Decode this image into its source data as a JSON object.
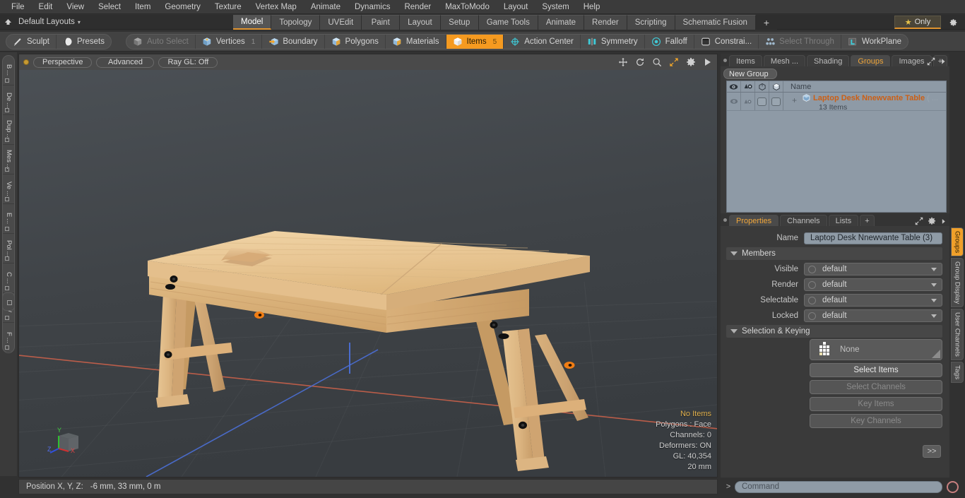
{
  "menu": {
    "items": [
      "File",
      "Edit",
      "View",
      "Select",
      "Item",
      "Geometry",
      "Texture",
      "Vertex Map",
      "Animate",
      "Dynamics",
      "Render",
      "MaxToModo",
      "Layout",
      "System",
      "Help"
    ]
  },
  "layout_bar": {
    "home_icon": "home-up-icon",
    "label": "Default Layouts",
    "caret": "▾",
    "tabs": [
      {
        "label": "Model",
        "active": true
      },
      {
        "label": "Topology",
        "active": false
      },
      {
        "label": "UVEdit",
        "active": false
      },
      {
        "label": "Paint",
        "active": false
      },
      {
        "label": "Layout",
        "active": false
      },
      {
        "label": "Setup",
        "active": false
      },
      {
        "label": "Game Tools",
        "active": false
      },
      {
        "label": "Animate",
        "active": false
      },
      {
        "label": "Render",
        "active": false
      },
      {
        "label": "Scripting",
        "active": false
      },
      {
        "label": "Schematic Fusion",
        "active": false
      }
    ],
    "add_label": "+",
    "only_label": "Only",
    "star_glyph": "★",
    "gear_icon": "gear-icon"
  },
  "mode_bar": {
    "group1": [
      {
        "label": "Sculpt",
        "icon": "pencil-icon",
        "state": "normal"
      },
      {
        "label": "Presets",
        "icon": "sphere-icon",
        "state": "normal"
      }
    ],
    "group2": [
      {
        "label": "Auto Select",
        "icon": "cube-gray-icon",
        "state": "dim"
      },
      {
        "label": "Vertices",
        "icon": "cube-vertex-icon",
        "state": "normal",
        "count": "1"
      },
      {
        "label": "Boundary",
        "icon": "cube-arrow-icon",
        "state": "normal"
      },
      {
        "label": "Polygons",
        "icon": "cube-blue-icon",
        "state": "normal"
      },
      {
        "label": "Materials",
        "icon": "cube-blue-icon",
        "state": "normal"
      },
      {
        "label": "Items",
        "icon": "cube-white-icon",
        "state": "selected",
        "count": "5"
      },
      {
        "label": "Action Center",
        "icon": "target-icon",
        "state": "normal"
      },
      {
        "label": "Symmetry",
        "icon": "symmetry-icon",
        "state": "normal"
      },
      {
        "label": "Falloff",
        "icon": "falloff-icon",
        "state": "normal"
      },
      {
        "label": "Constrai...",
        "icon": "constraint-icon",
        "state": "normal"
      },
      {
        "label": "Select Through",
        "icon": "select-through-icon",
        "state": "dim"
      },
      {
        "label": "WorkPlane",
        "icon": "workplane-icon",
        "state": "normal"
      }
    ]
  },
  "left_tabs": [
    "B ...",
    "De ...",
    "Dup ...",
    "Mes ...",
    "Ve ...",
    "E ...",
    "Pol ...",
    "C ...",
    "UV",
    "F ..."
  ],
  "viewport": {
    "mode_label": "Perspective",
    "quality_label": "Advanced",
    "raygl_label": "Ray GL: Off",
    "header_icons": [
      "move-icon",
      "rotate-icon",
      "zoom-icon",
      "fit-icon",
      "gear-icon",
      "play-icon"
    ],
    "info": {
      "items": "No Items",
      "polygons": "Polygons : Face",
      "channels": "Channels: 0",
      "deformers": "Deformers: ON",
      "gl": "GL: 40,354",
      "scale": "20 mm"
    },
    "axis": {
      "x": "X",
      "y": "Y",
      "z": "Z"
    },
    "model_name": "laptop-desk-table-3d-model"
  },
  "status_bar": {
    "label": "Position X, Y, Z:",
    "value": "-6 mm, 33 mm, 0 m"
  },
  "right_panel": {
    "tabs": [
      {
        "label": "Items",
        "active": false
      },
      {
        "label": "Mesh ...",
        "active": false
      },
      {
        "label": "Shading",
        "active": false
      },
      {
        "label": "Groups",
        "active": true
      },
      {
        "label": "Images",
        "active": false
      },
      {
        "label": "+",
        "active": false
      }
    ],
    "new_group_label": "New Group",
    "list": {
      "header_cols": [
        "eye-icon",
        "render-icon",
        "outline-cube-icon",
        "shaded-cube-icon"
      ],
      "name_header": "Name",
      "rows": [
        {
          "title": "Laptop Desk Nnewvante Table",
          "paren": "(",
          "ellipsis": "...",
          "subtitle": "13 Items",
          "expand": "+"
        }
      ]
    }
  },
  "properties": {
    "tabs": [
      {
        "label": "Properties",
        "active": true
      },
      {
        "label": "Channels",
        "active": false
      },
      {
        "label": "Lists",
        "active": false
      },
      {
        "label": "+",
        "active": false
      }
    ],
    "name_label": "Name",
    "name_value": "Laptop Desk Nnewvante Table (3)",
    "members_section": "Members",
    "fields": [
      {
        "label": "Visible",
        "value": "default"
      },
      {
        "label": "Render",
        "value": "default"
      },
      {
        "label": "Selectable",
        "value": "default"
      },
      {
        "label": "Locked",
        "value": "default"
      }
    ],
    "selection_section": "Selection & Keying",
    "keyset_value": "None",
    "buttons": [
      {
        "label": "Select Items",
        "enabled": true
      },
      {
        "label": "Select Channels",
        "enabled": false
      },
      {
        "label": "Key Items",
        "enabled": false
      },
      {
        "label": "Key Channels",
        "enabled": false
      }
    ],
    "more_label": ">>"
  },
  "right_vtabs": [
    {
      "label": "Groups",
      "active": true
    },
    {
      "label": "Group Display",
      "active": false
    },
    {
      "label": "User Channels",
      "active": false
    },
    {
      "label": "Tags",
      "active": false
    }
  ],
  "command_bar": {
    "prompt": ">",
    "placeholder": "Command",
    "record_icon": "record-circle-icon"
  },
  "colors": {
    "accent_orange": "#f0a02a",
    "selected_orange": "#f59a20",
    "panel_bg": "#3a3a3a",
    "list_blue": "#8e9aa6",
    "warning_yellow": "#e2b24e"
  }
}
